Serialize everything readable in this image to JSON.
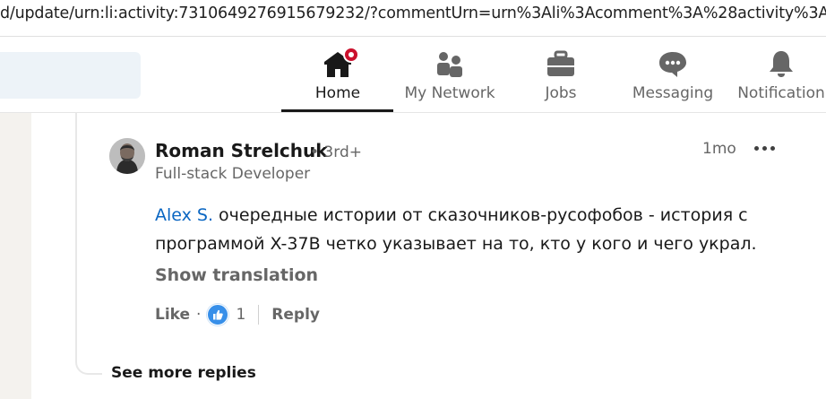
{
  "browser": {
    "url": "d/update/urn:li:activity:7310649276915679232/?commentUrn=urn%3Ali%3Acomment%3A%28activity%3A73106492769"
  },
  "nav": {
    "items": [
      {
        "label": "Home",
        "icon": "home-icon",
        "active": true
      },
      {
        "label": "My Network",
        "icon": "people-icon"
      },
      {
        "label": "Jobs",
        "icon": "briefcase-icon"
      },
      {
        "label": "Messaging",
        "icon": "chat-icon"
      },
      {
        "label": "Notification",
        "icon": "bell-icon"
      }
    ]
  },
  "comment": {
    "author": "Roman Strelchuk",
    "degree": "• 3rd+",
    "headline": "Full-stack Developer",
    "time": "1mo",
    "mention": "Alex S.",
    "text": " очередные истории от сказочников-русофобов - история с программой X-37B четко указывает на то, кто у кого и чего украл.",
    "show_translation": "Show translation",
    "like_label": "Like",
    "dot": "·",
    "reaction_count": "1",
    "reply_label": "Reply"
  },
  "see_more_replies": "See more replies",
  "colors": {
    "accent": "#0a66c2",
    "badge": "#cb112d",
    "reaction": "#378fe9"
  }
}
